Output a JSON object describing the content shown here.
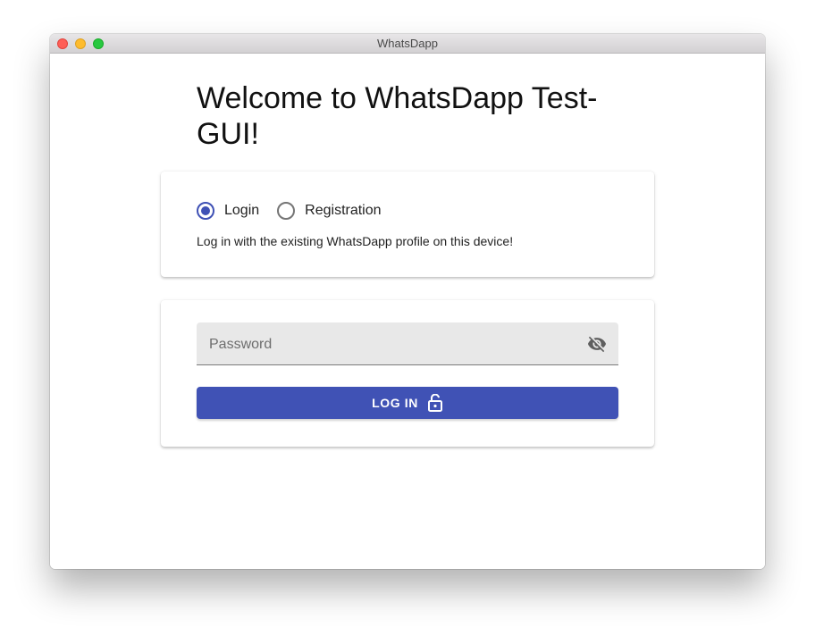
{
  "window": {
    "title": "WhatsDapp"
  },
  "page": {
    "heading": "Welcome to WhatsDapp Test-GUI!"
  },
  "mode_card": {
    "options": [
      {
        "label": "Login",
        "selected": true
      },
      {
        "label": "Registration",
        "selected": false
      }
    ],
    "hint": "Log in with the existing WhatsDapp profile on this device!"
  },
  "auth_card": {
    "password": {
      "placeholder": "Password",
      "value": "",
      "toggle_icon": "visibility-off-icon"
    },
    "login_button": {
      "label": "LOG IN",
      "icon": "lock-open-icon"
    }
  },
  "colors": {
    "accent": "#3f51b5",
    "button": "#4052b5",
    "field_bg": "#e8e8e8"
  }
}
